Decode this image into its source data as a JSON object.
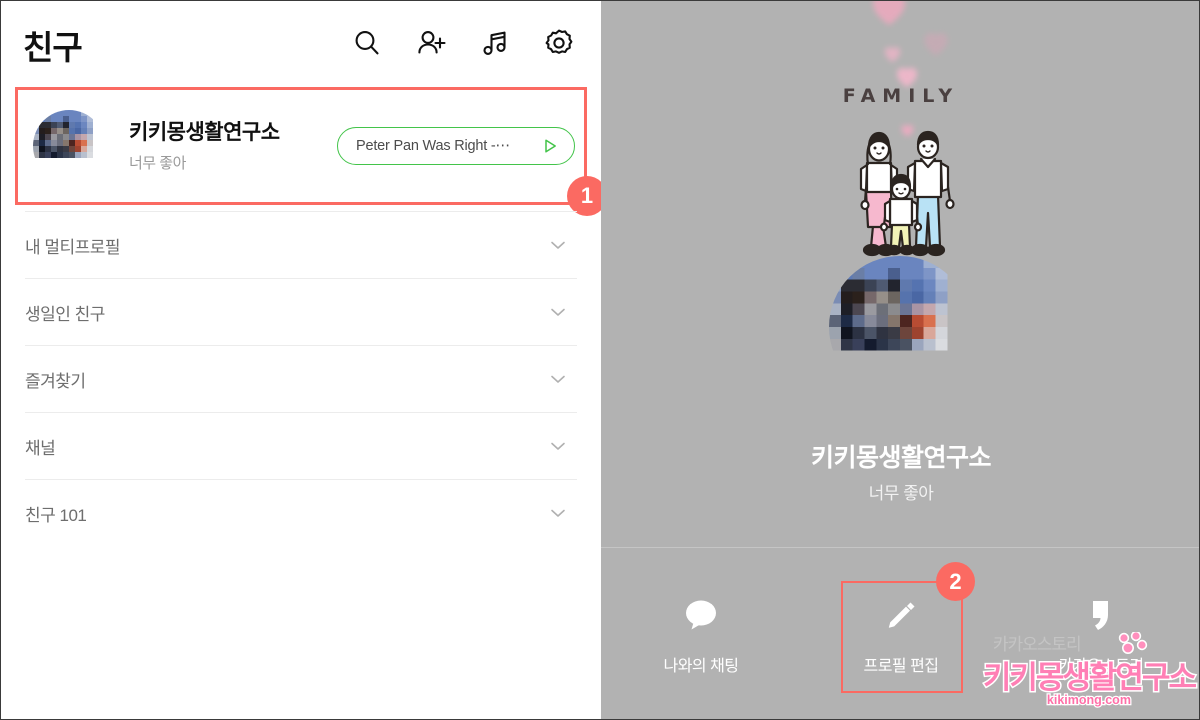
{
  "header": {
    "title": "친구",
    "icons": [
      {
        "name": "search-icon",
        "label": "검색"
      },
      {
        "name": "add-friend-icon",
        "label": "친구추가"
      },
      {
        "name": "music-icon",
        "label": "뮤직"
      },
      {
        "name": "settings-icon",
        "label": "설정"
      }
    ]
  },
  "friend_row": {
    "name": "키키몽생활연구소",
    "status": "너무 좋아",
    "music_chip": {
      "label": "Peter Pan Was Right -⋯",
      "border_color": "#43c44a"
    }
  },
  "sections": [
    {
      "label": "내 멀티프로필"
    },
    {
      "label": "생일인 친구"
    },
    {
      "label": "즐겨찾기"
    },
    {
      "label": "채널"
    },
    {
      "label": "친구 101"
    }
  ],
  "profile": {
    "family_word": "FAMILY",
    "name": "키키몽생활연구소",
    "status": "너무 좋아",
    "background_color": "#b2b2b2"
  },
  "actions": [
    {
      "icon": "chat-bubble-icon",
      "label": "나와의 채팅"
    },
    {
      "icon": "pencil-icon",
      "label": "프로필 편집"
    },
    {
      "icon": "quote-icon",
      "label": "카카오스토리"
    }
  ],
  "annotations": {
    "badge_1": "1",
    "badge_2": "2",
    "accent_color": "#fb6a62"
  },
  "watermark": {
    "faint_brand": "카카오스토리",
    "main": "키키몽생활연구소",
    "url": "kikimong.com"
  }
}
